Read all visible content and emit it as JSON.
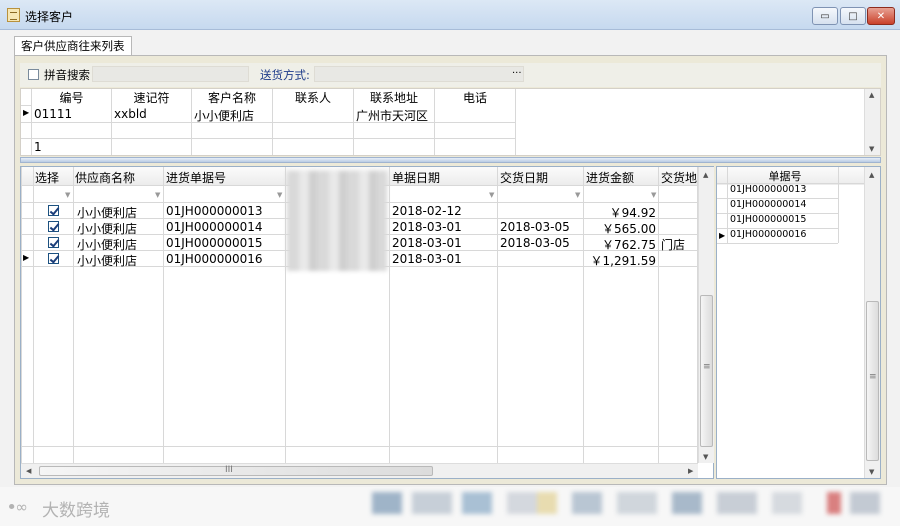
{
  "window": {
    "title": "选择客户",
    "minimize": "▭",
    "maximize": "□",
    "close": "✕"
  },
  "tabs": [
    {
      "label": "客户供应商往来列表"
    }
  ],
  "search": {
    "pinyin_label": "拼音搜索",
    "pinyin_checked": false,
    "search_value": "",
    "delivery_label": "送货方式:",
    "delivery_value": "",
    "delivery_button": "..."
  },
  "customer_grid": {
    "columns": [
      "编号",
      "速记符",
      "客户名称",
      "联系人",
      "联系地址",
      "电话"
    ],
    "rows": [
      [
        "01111",
        "xxbld",
        "小小便利店",
        "",
        "广州市天河区",
        ""
      ]
    ],
    "footer_count": "1"
  },
  "orders_grid": {
    "columns": [
      "选择",
      "供应商名称",
      "进货单据号",
      "",
      "单据日期",
      "交货日期",
      "进货金额",
      "交货地"
    ],
    "rows": [
      {
        "selected": true,
        "supplier": "小小便利店",
        "doc_no": "01JH000000013",
        "date": "2018-02-12",
        "delivery_date": "",
        "amount": "￥94.92",
        "place": ""
      },
      {
        "selected": true,
        "supplier": "小小便利店",
        "doc_no": "01JH000000014",
        "date": "2018-03-01",
        "delivery_date": "2018-03-05",
        "amount": "￥565.00",
        "place": ""
      },
      {
        "selected": true,
        "supplier": "小小便利店",
        "doc_no": "01JH000000015",
        "date": "2018-03-01",
        "delivery_date": "2018-03-05",
        "amount": "￥762.75",
        "place": "门店"
      },
      {
        "selected": true,
        "supplier": "小小便利店",
        "doc_no": "01JH000000016",
        "date": "2018-03-01",
        "delivery_date": "",
        "amount": "￥1,291.59",
        "place": ""
      }
    ],
    "hscroll_grip": "III",
    "vscroll_grip": "≡"
  },
  "selected_docs": {
    "header": "单据号",
    "items": [
      "01JH000000013",
      "01JH000000014",
      "01JH000000015",
      "01JH000000016"
    ],
    "vscroll_grip": "≡"
  },
  "watermark": {
    "logo": "ꔷ∞",
    "text": "大数跨境"
  },
  "colors": {
    "titlebar": "#c6d9ef",
    "close": "#c9402a",
    "grid_border": "#9bb0c7"
  }
}
